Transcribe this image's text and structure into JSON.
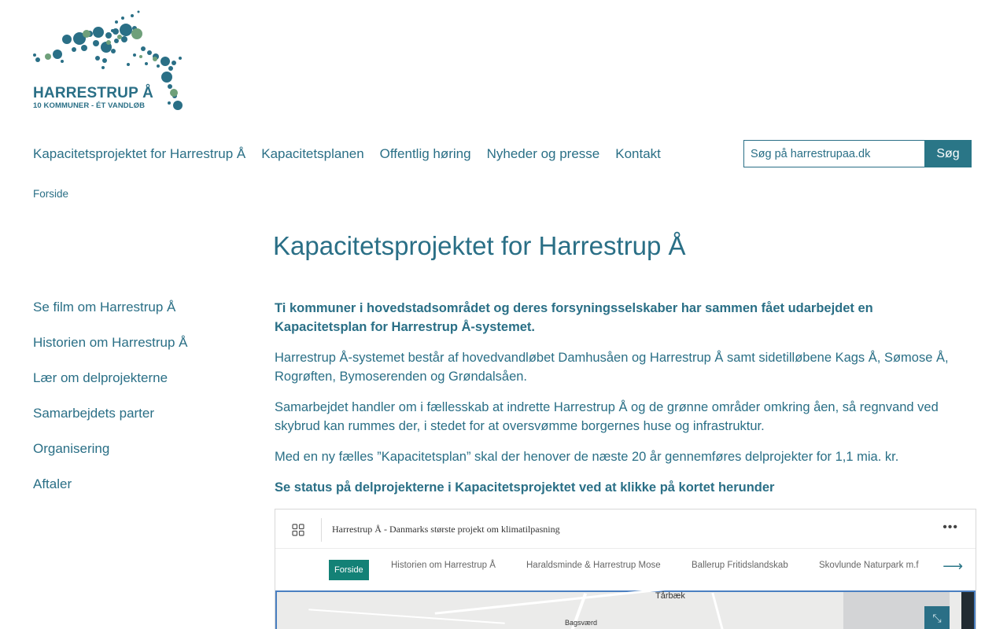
{
  "logo": {
    "title": "HARRESTRUP Å",
    "subtitle": "10 KOMMUNER - ÉT VANDLØB"
  },
  "nav": {
    "items": [
      "Kapacitetsprojektet for Harrestrup Å",
      "Kapacitetsplanen",
      "Offentlig høring",
      "Nyheder og presse",
      "Kontakt"
    ]
  },
  "search": {
    "placeholder": "Søg på harrestrupaa.dk",
    "button_label": "Søg"
  },
  "breadcrumb": {
    "home": "Forside"
  },
  "page": {
    "title": "Kapacitetsprojektet for Harrestrup Å"
  },
  "sidebar": {
    "items": [
      "Se film om Harrestrup Å",
      "Historien om Harrestrup Å",
      "Lær om delprojekterne",
      "Samarbejdets parter",
      "Organisering",
      "Aftaler"
    ]
  },
  "content": {
    "lead": "Ti kommuner i hovedstadsområdet og deres forsyningsselskaber har sammen fået udarbejdet en Kapacitetsplan for Harrestrup Å-systemet.",
    "p1": "Harrestrup Å-systemet består af hovedvandløbet Damhusåen og Harrestrup Å samt sidetilløbene Kags Å, Sømose Å, Rogrøften, Bymoserenden og Grøndalsåen.",
    "p2": "Samarbejdet handler om i fællesskab at indrette Harrestrup Å og de grønne områder omkring åen, så regnvand ved skybrud kan rummes der, i stedet for at oversvømme borgernes huse og infrastruktur.",
    "p3": "Med en ny fælles ”Kapacitetsplan” skal der henover de næste 20 år gennemføres delprojekter for 1,1 mia. kr.",
    "cta": "Se status på delprojekterne i Kapacitetsprojektet ved at klikke på kortet herunder"
  },
  "embed": {
    "title": "Harrestrup Å - Danmarks største projekt om klimatilpasning",
    "tabs": [
      "Forside",
      "Historien om Harrestrup Å",
      "Haraldsminde & Harrestrup Mose",
      "Ballerup Fritidslandskab",
      "Skovlunde Naturpark m.f"
    ],
    "map_labels": [
      "Tårbæk",
      "Bagsværd"
    ]
  },
  "colors": {
    "brand": "#2a6f86",
    "button": "#2a7687",
    "tab_active": "#138176"
  }
}
